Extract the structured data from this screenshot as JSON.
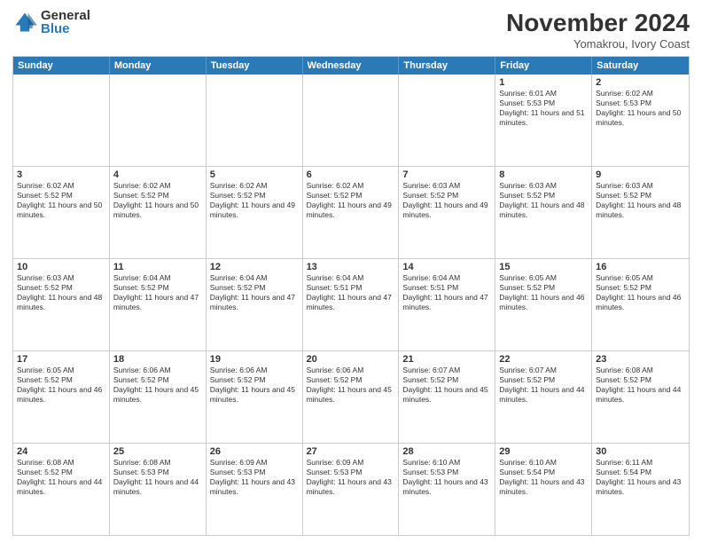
{
  "logo": {
    "general": "General",
    "blue": "Blue"
  },
  "header": {
    "month": "November 2024",
    "location": "Yomakrou, Ivory Coast"
  },
  "days": [
    "Sunday",
    "Monday",
    "Tuesday",
    "Wednesday",
    "Thursday",
    "Friday",
    "Saturday"
  ],
  "weeks": [
    [
      {
        "day": "",
        "empty": true
      },
      {
        "day": "",
        "empty": true
      },
      {
        "day": "",
        "empty": true
      },
      {
        "day": "",
        "empty": true
      },
      {
        "day": "",
        "empty": true
      },
      {
        "day": "1",
        "sunrise": "Sunrise: 6:01 AM",
        "sunset": "Sunset: 5:53 PM",
        "daylight": "Daylight: 11 hours and 51 minutes."
      },
      {
        "day": "2",
        "sunrise": "Sunrise: 6:02 AM",
        "sunset": "Sunset: 5:53 PM",
        "daylight": "Daylight: 11 hours and 50 minutes."
      }
    ],
    [
      {
        "day": "3",
        "sunrise": "Sunrise: 6:02 AM",
        "sunset": "Sunset: 5:52 PM",
        "daylight": "Daylight: 11 hours and 50 minutes."
      },
      {
        "day": "4",
        "sunrise": "Sunrise: 6:02 AM",
        "sunset": "Sunset: 5:52 PM",
        "daylight": "Daylight: 11 hours and 50 minutes."
      },
      {
        "day": "5",
        "sunrise": "Sunrise: 6:02 AM",
        "sunset": "Sunset: 5:52 PM",
        "daylight": "Daylight: 11 hours and 49 minutes."
      },
      {
        "day": "6",
        "sunrise": "Sunrise: 6:02 AM",
        "sunset": "Sunset: 5:52 PM",
        "daylight": "Daylight: 11 hours and 49 minutes."
      },
      {
        "day": "7",
        "sunrise": "Sunrise: 6:03 AM",
        "sunset": "Sunset: 5:52 PM",
        "daylight": "Daylight: 11 hours and 49 minutes."
      },
      {
        "day": "8",
        "sunrise": "Sunrise: 6:03 AM",
        "sunset": "Sunset: 5:52 PM",
        "daylight": "Daylight: 11 hours and 48 minutes."
      },
      {
        "day": "9",
        "sunrise": "Sunrise: 6:03 AM",
        "sunset": "Sunset: 5:52 PM",
        "daylight": "Daylight: 11 hours and 48 minutes."
      }
    ],
    [
      {
        "day": "10",
        "sunrise": "Sunrise: 6:03 AM",
        "sunset": "Sunset: 5:52 PM",
        "daylight": "Daylight: 11 hours and 48 minutes."
      },
      {
        "day": "11",
        "sunrise": "Sunrise: 6:04 AM",
        "sunset": "Sunset: 5:52 PM",
        "daylight": "Daylight: 11 hours and 47 minutes."
      },
      {
        "day": "12",
        "sunrise": "Sunrise: 6:04 AM",
        "sunset": "Sunset: 5:52 PM",
        "daylight": "Daylight: 11 hours and 47 minutes."
      },
      {
        "day": "13",
        "sunrise": "Sunrise: 6:04 AM",
        "sunset": "Sunset: 5:51 PM",
        "daylight": "Daylight: 11 hours and 47 minutes."
      },
      {
        "day": "14",
        "sunrise": "Sunrise: 6:04 AM",
        "sunset": "Sunset: 5:51 PM",
        "daylight": "Daylight: 11 hours and 47 minutes."
      },
      {
        "day": "15",
        "sunrise": "Sunrise: 6:05 AM",
        "sunset": "Sunset: 5:52 PM",
        "daylight": "Daylight: 11 hours and 46 minutes."
      },
      {
        "day": "16",
        "sunrise": "Sunrise: 6:05 AM",
        "sunset": "Sunset: 5:52 PM",
        "daylight": "Daylight: 11 hours and 46 minutes."
      }
    ],
    [
      {
        "day": "17",
        "sunrise": "Sunrise: 6:05 AM",
        "sunset": "Sunset: 5:52 PM",
        "daylight": "Daylight: 11 hours and 46 minutes."
      },
      {
        "day": "18",
        "sunrise": "Sunrise: 6:06 AM",
        "sunset": "Sunset: 5:52 PM",
        "daylight": "Daylight: 11 hours and 45 minutes."
      },
      {
        "day": "19",
        "sunrise": "Sunrise: 6:06 AM",
        "sunset": "Sunset: 5:52 PM",
        "daylight": "Daylight: 11 hours and 45 minutes."
      },
      {
        "day": "20",
        "sunrise": "Sunrise: 6:06 AM",
        "sunset": "Sunset: 5:52 PM",
        "daylight": "Daylight: 11 hours and 45 minutes."
      },
      {
        "day": "21",
        "sunrise": "Sunrise: 6:07 AM",
        "sunset": "Sunset: 5:52 PM",
        "daylight": "Daylight: 11 hours and 45 minutes."
      },
      {
        "day": "22",
        "sunrise": "Sunrise: 6:07 AM",
        "sunset": "Sunset: 5:52 PM",
        "daylight": "Daylight: 11 hours and 44 minutes."
      },
      {
        "day": "23",
        "sunrise": "Sunrise: 6:08 AM",
        "sunset": "Sunset: 5:52 PM",
        "daylight": "Daylight: 11 hours and 44 minutes."
      }
    ],
    [
      {
        "day": "24",
        "sunrise": "Sunrise: 6:08 AM",
        "sunset": "Sunset: 5:52 PM",
        "daylight": "Daylight: 11 hours and 44 minutes."
      },
      {
        "day": "25",
        "sunrise": "Sunrise: 6:08 AM",
        "sunset": "Sunset: 5:53 PM",
        "daylight": "Daylight: 11 hours and 44 minutes."
      },
      {
        "day": "26",
        "sunrise": "Sunrise: 6:09 AM",
        "sunset": "Sunset: 5:53 PM",
        "daylight": "Daylight: 11 hours and 43 minutes."
      },
      {
        "day": "27",
        "sunrise": "Sunrise: 6:09 AM",
        "sunset": "Sunset: 5:53 PM",
        "daylight": "Daylight: 11 hours and 43 minutes."
      },
      {
        "day": "28",
        "sunrise": "Sunrise: 6:10 AM",
        "sunset": "Sunset: 5:53 PM",
        "daylight": "Daylight: 11 hours and 43 minutes."
      },
      {
        "day": "29",
        "sunrise": "Sunrise: 6:10 AM",
        "sunset": "Sunset: 5:54 PM",
        "daylight": "Daylight: 11 hours and 43 minutes."
      },
      {
        "day": "30",
        "sunrise": "Sunrise: 6:11 AM",
        "sunset": "Sunset: 5:54 PM",
        "daylight": "Daylight: 11 hours and 43 minutes."
      }
    ]
  ]
}
